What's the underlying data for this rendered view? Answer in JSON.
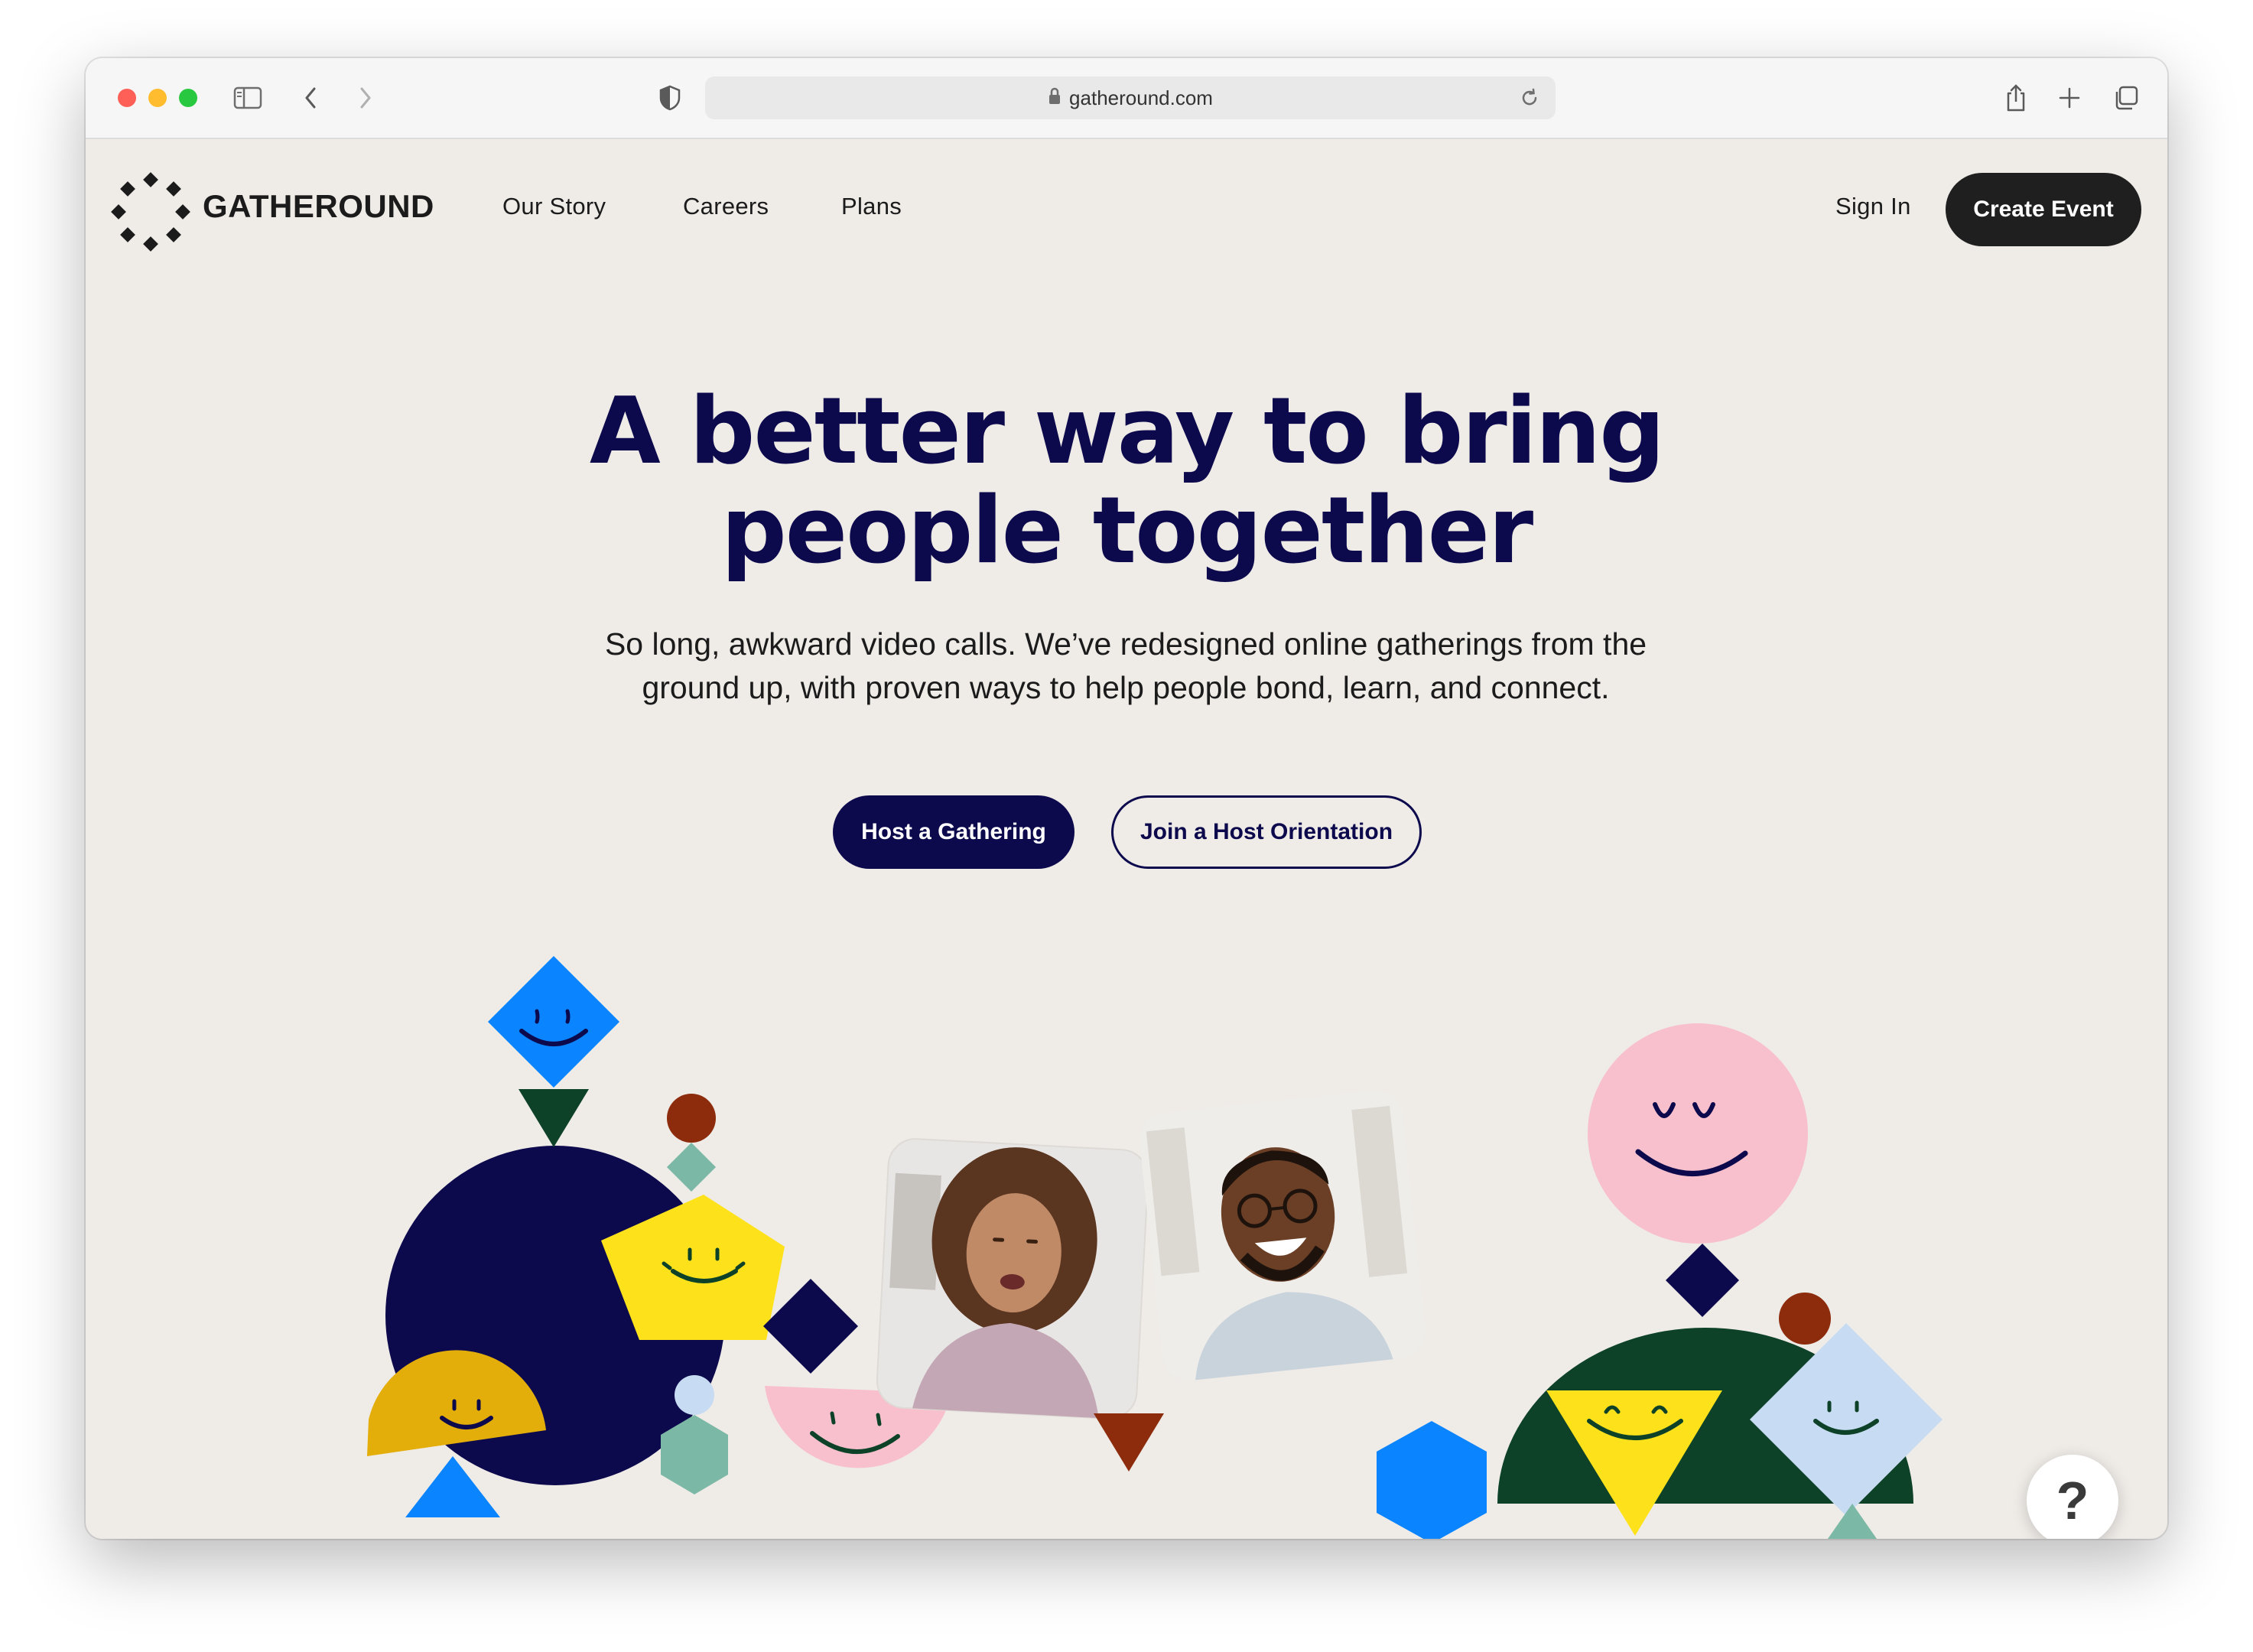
{
  "browser": {
    "url": "gatheround.com",
    "icons": [
      "sidebar-icon",
      "back-icon",
      "forward-icon",
      "shield-icon",
      "lock-icon",
      "reload-icon",
      "share-icon",
      "new-tab-icon",
      "tabs-overview-icon"
    ]
  },
  "nav": {
    "brand": "GATHEROUND",
    "links": [
      "Our Story",
      "Careers",
      "Plans"
    ],
    "sign_in": "Sign In",
    "create_event": "Create Event"
  },
  "hero": {
    "title_line1": "A better way to bring",
    "title_line2": "people together",
    "subtitle_line1": "So long, awkward video calls. We’ve redesigned online gatherings from the",
    "subtitle_line2": "ground up, with proven ways to help people bond, learn, and connect.",
    "primary_cta": "Host a Gathering",
    "secondary_cta": "Join a Host Orientation"
  },
  "help": {
    "label": "?"
  },
  "colors": {
    "navy": "#0c0a4d",
    "background": "#efebe7",
    "blue": "#0a84ff",
    "yellow": "#fde21b",
    "mustard": "#e3ad0a",
    "pink": "#f8c0cc",
    "sage": "#7bb8a5",
    "dark_green": "#0d4229",
    "rust": "#8c2c0c",
    "light_blue": "#c7dcf2"
  }
}
